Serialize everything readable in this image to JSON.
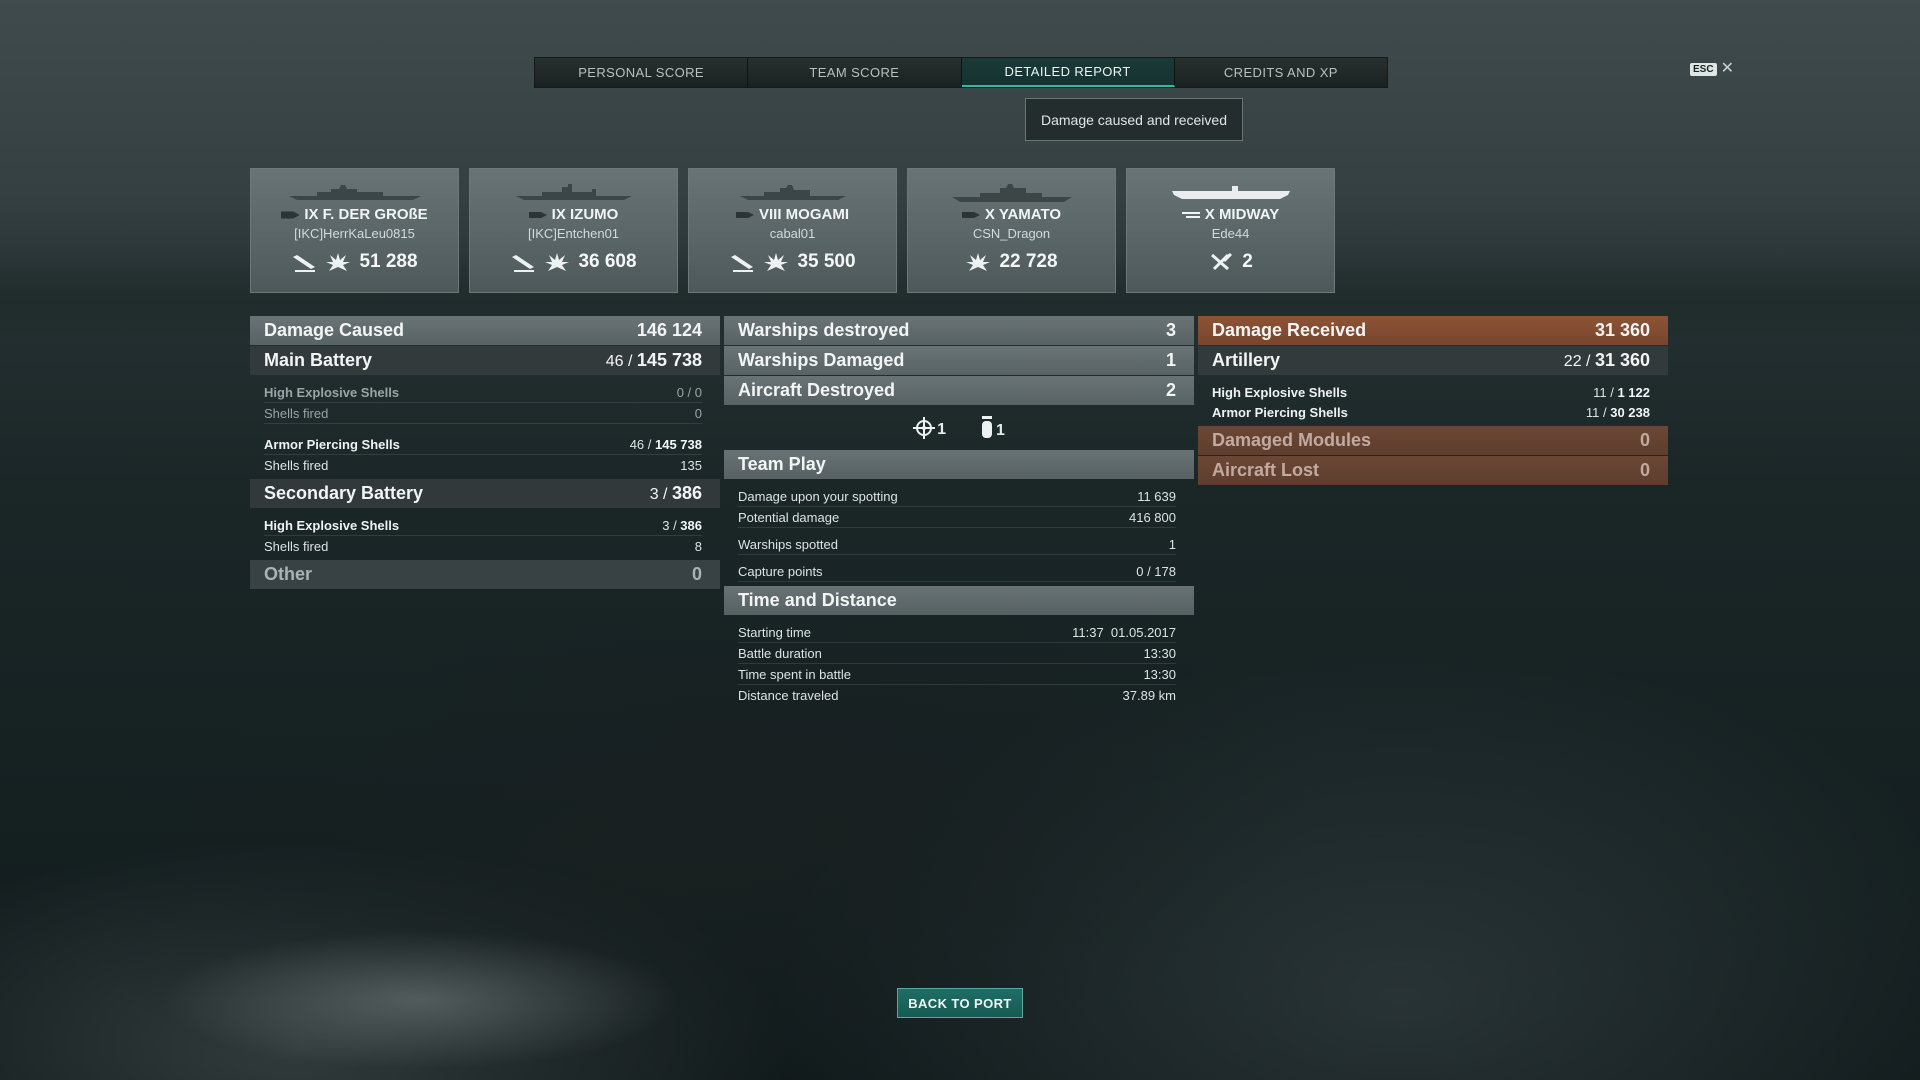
{
  "tabs": [
    {
      "label": "PERSONAL SCORE",
      "active": false
    },
    {
      "label": "TEAM SCORE",
      "active": false
    },
    {
      "label": "DETAILED REPORT",
      "active": true
    },
    {
      "label": "CREDITS AND XP",
      "active": false
    }
  ],
  "esc": {
    "key": "ESC",
    "close": "✕"
  },
  "subtitle": "Damage caused and received",
  "ships": [
    {
      "name": "IX F. DER GROßE",
      "player": "[IKC]HerrKaLeu0815",
      "damage": "51 288",
      "icons": [
        "torpedo-hit-icon",
        "damage-burst-icon"
      ]
    },
    {
      "name": "IX IZUMO",
      "player": "[IKC]Entchen01",
      "damage": "36 608",
      "icons": [
        "torpedo-hit-icon",
        "damage-burst-icon"
      ]
    },
    {
      "name": "VIII MOGAMI",
      "player": "cabal01",
      "damage": "35 500",
      "icons": [
        "torpedo-hit-icon",
        "damage-burst-icon"
      ]
    },
    {
      "name": "X YAMATO",
      "player": "CSN_Dragon",
      "damage": "22 728",
      "icons": [
        "damage-burst-icon"
      ]
    },
    {
      "name": "X MIDWAY",
      "player": "Ede44",
      "damage": "2",
      "icons": [
        "plane-shot-down-icon"
      ]
    }
  ],
  "damage_caused": {
    "title": "Damage Caused",
    "total": "146 124",
    "main_battery": {
      "title": "Main Battery",
      "hits": "46",
      "damage": "145 738"
    },
    "mb_he": {
      "label": "High Explosive Shells",
      "hits": "0",
      "damage": "0",
      "fired_label": "Shells fired",
      "fired": "0"
    },
    "mb_ap": {
      "label": "Armor Piercing Shells",
      "hits": "46",
      "damage": "145 738",
      "fired_label": "Shells fired",
      "fired": "135"
    },
    "secondary": {
      "title": "Secondary Battery",
      "hits": "3",
      "damage": "386"
    },
    "sec_he": {
      "label": "High Explosive Shells",
      "hits": "3",
      "damage": "386",
      "fired_label": "Shells fired",
      "fired": "8"
    },
    "other": {
      "title": "Other",
      "value": "0"
    }
  },
  "middle": {
    "warships_destroyed": {
      "label": "Warships destroyed",
      "value": "3"
    },
    "warships_damaged": {
      "label": "Warships Damaged",
      "value": "1"
    },
    "aircraft_destroyed": {
      "label": "Aircraft Destroyed",
      "value": "2"
    },
    "aircraft_icons": [
      {
        "icon": "crosshair-icon",
        "value": "1"
      },
      {
        "icon": "bomb-icon",
        "value": "1"
      }
    ],
    "team_play": {
      "title": "Team Play",
      "rows": [
        {
          "label": "Damage upon your spotting",
          "value": "11 639"
        },
        {
          "label": "Potential damage",
          "value": "416 800"
        },
        {
          "label": "Warships spotted",
          "value": "1"
        },
        {
          "label": "Capture points",
          "value": "0 / 178"
        }
      ]
    },
    "time_distance": {
      "title": "Time and Distance",
      "rows": [
        {
          "label": "Starting time",
          "value": "11:37  01.05.2017"
        },
        {
          "label": "Battle duration",
          "value": "13:30"
        },
        {
          "label": "Time spent in battle",
          "value": "13:30"
        },
        {
          "label": "Distance traveled",
          "value": "37.89 km"
        }
      ]
    }
  },
  "damage_received": {
    "title": "Damage Received",
    "total": "31 360",
    "artillery": {
      "title": "Artillery",
      "hits": "22",
      "damage": "31 360"
    },
    "he": {
      "label": "High Explosive Shells",
      "hits": "11",
      "damage": "1 122"
    },
    "ap": {
      "label": "Armor Piercing Shells",
      "hits": "11",
      "damage": "30 238"
    },
    "modules": {
      "title": "Damaged Modules",
      "value": "0"
    },
    "aircraft_lost": {
      "title": "Aircraft Lost",
      "value": "0"
    }
  },
  "back_button": "BACK TO PORT"
}
